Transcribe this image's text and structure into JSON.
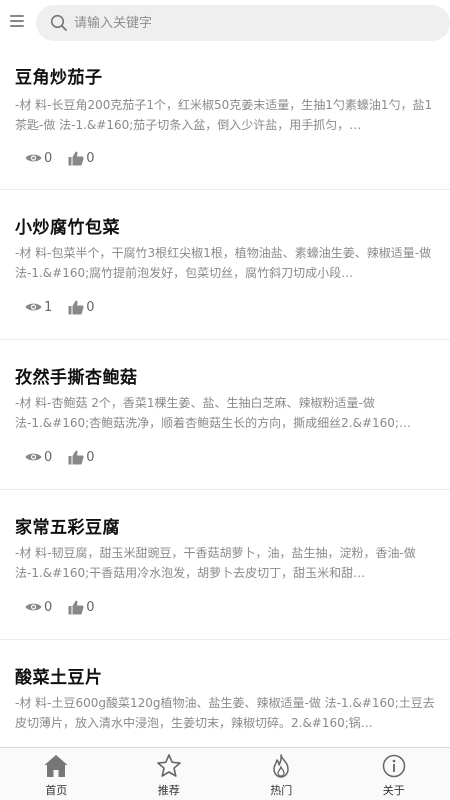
{
  "search": {
    "placeholder": "请输入关键字"
  },
  "recipes": [
    {
      "title": "豆角炒茄子",
      "desc": "-材 料-长豆角200克茄子1个，红米椒50克姜末适量，生抽1勺素蠔油1勺，盐1茶匙-做 法-1.&#160;茄子切条入盆，倒入少许盐，用手抓匀，…",
      "views": "0",
      "likes": "0"
    },
    {
      "title": "小炒腐竹包菜",
      "desc": "-材 料-包菜半个，干腐竹3根红尖椒1根，植物油盐、素蠔油生姜、辣椒适量-做 法-1.&#160;腐竹提前泡发好，包菜切丝，腐竹斜刀切成小段…",
      "views": "1",
      "likes": "0"
    },
    {
      "title": "孜然手撕杏鲍菇",
      "desc": "-材 料-杏鲍菇 2个，香菜1棵生姜、盐、生抽白芝麻、辣椒粉适量-做 法-1.&#160;杏鲍菇洗净，顺着杏鲍菇生长的方向，撕成细丝2.&#160;…",
      "views": "0",
      "likes": "0"
    },
    {
      "title": "家常五彩豆腐",
      "desc": "-材 料-韧豆腐，甜玉米甜豌豆，干香菇胡萝卜，油，盐生抽，淀粉，香油-做 法-1.&#160;干香菇用冷水泡发，胡萝卜去皮切丁，甜玉米和甜…",
      "views": "0",
      "likes": "0"
    },
    {
      "title": "酸菜土豆片",
      "desc": "-材 料-土豆600g酸菜120g植物油、盐生姜、辣椒适量-做 法-1.&#160;土豆去皮切薄片，放入清水中浸泡，生姜切末，辣椒切碎。2.&#160;锅…",
      "views": "",
      "likes": ""
    }
  ],
  "tabs": [
    {
      "label": "首页",
      "icon": "home-icon"
    },
    {
      "label": "推荐",
      "icon": "star-icon"
    },
    {
      "label": "热门",
      "icon": "flame-icon"
    },
    {
      "label": "关于",
      "icon": "info-icon"
    }
  ],
  "colors": {
    "icon_gray": "#888888",
    "text_gray": "#8a8a8a"
  }
}
